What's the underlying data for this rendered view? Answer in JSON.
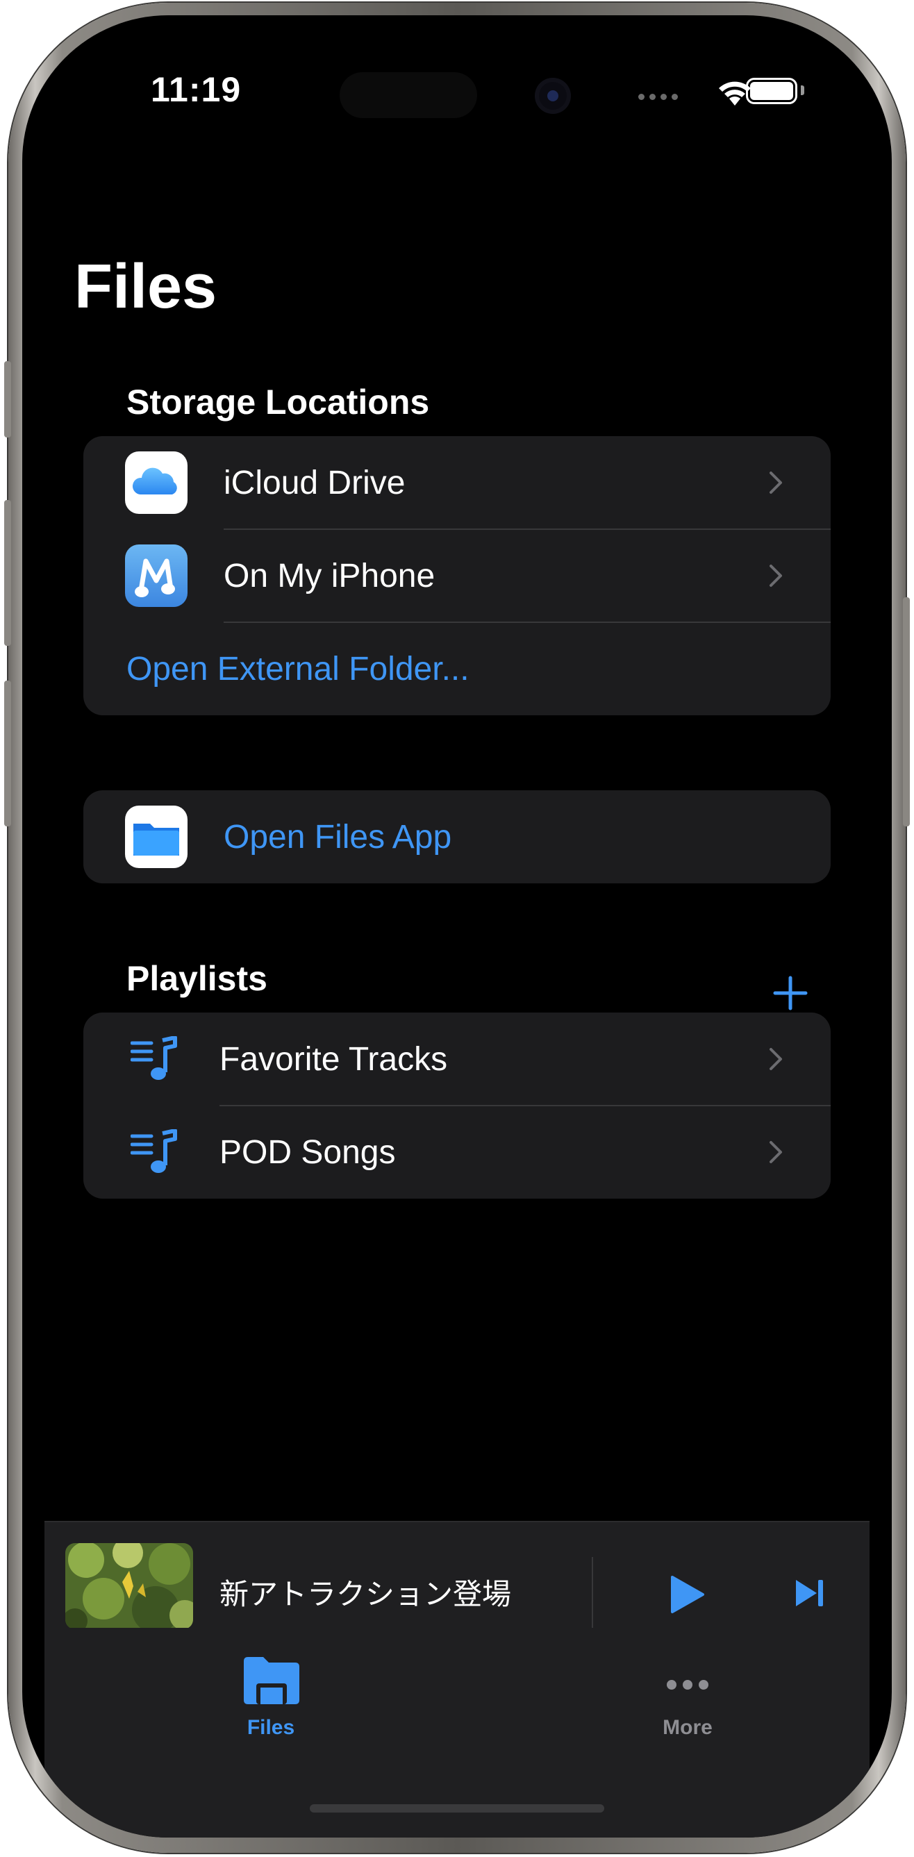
{
  "status_bar": {
    "time": "11:19"
  },
  "page": {
    "title": "Files"
  },
  "storage": {
    "header": "Storage Locations",
    "items": [
      {
        "label": "iCloud Drive",
        "icon": "icloud-icon"
      },
      {
        "label": "On My iPhone",
        "icon": "music-app-icon"
      }
    ],
    "open_external": "Open External Folder..."
  },
  "files_app": {
    "label": "Open Files App",
    "icon": "files-folder-icon"
  },
  "playlists": {
    "header": "Playlists",
    "add_icon": "plus-icon",
    "items": [
      {
        "label": "Favorite Tracks",
        "icon": "playlist-icon"
      },
      {
        "label": "POD Songs",
        "icon": "playlist-icon"
      }
    ]
  },
  "mini_player": {
    "title": "新アトラクション登場",
    "play_icon": "play-icon",
    "next_icon": "next-track-icon"
  },
  "tabs": [
    {
      "label": "Files",
      "icon": "folder-icon",
      "active": true
    },
    {
      "label": "More",
      "icon": "ellipsis-icon",
      "active": false
    }
  ],
  "colors": {
    "accent": "#3f96f5",
    "background": "#000000",
    "card": "#1c1c1e",
    "inactive": "#8e8e93"
  }
}
